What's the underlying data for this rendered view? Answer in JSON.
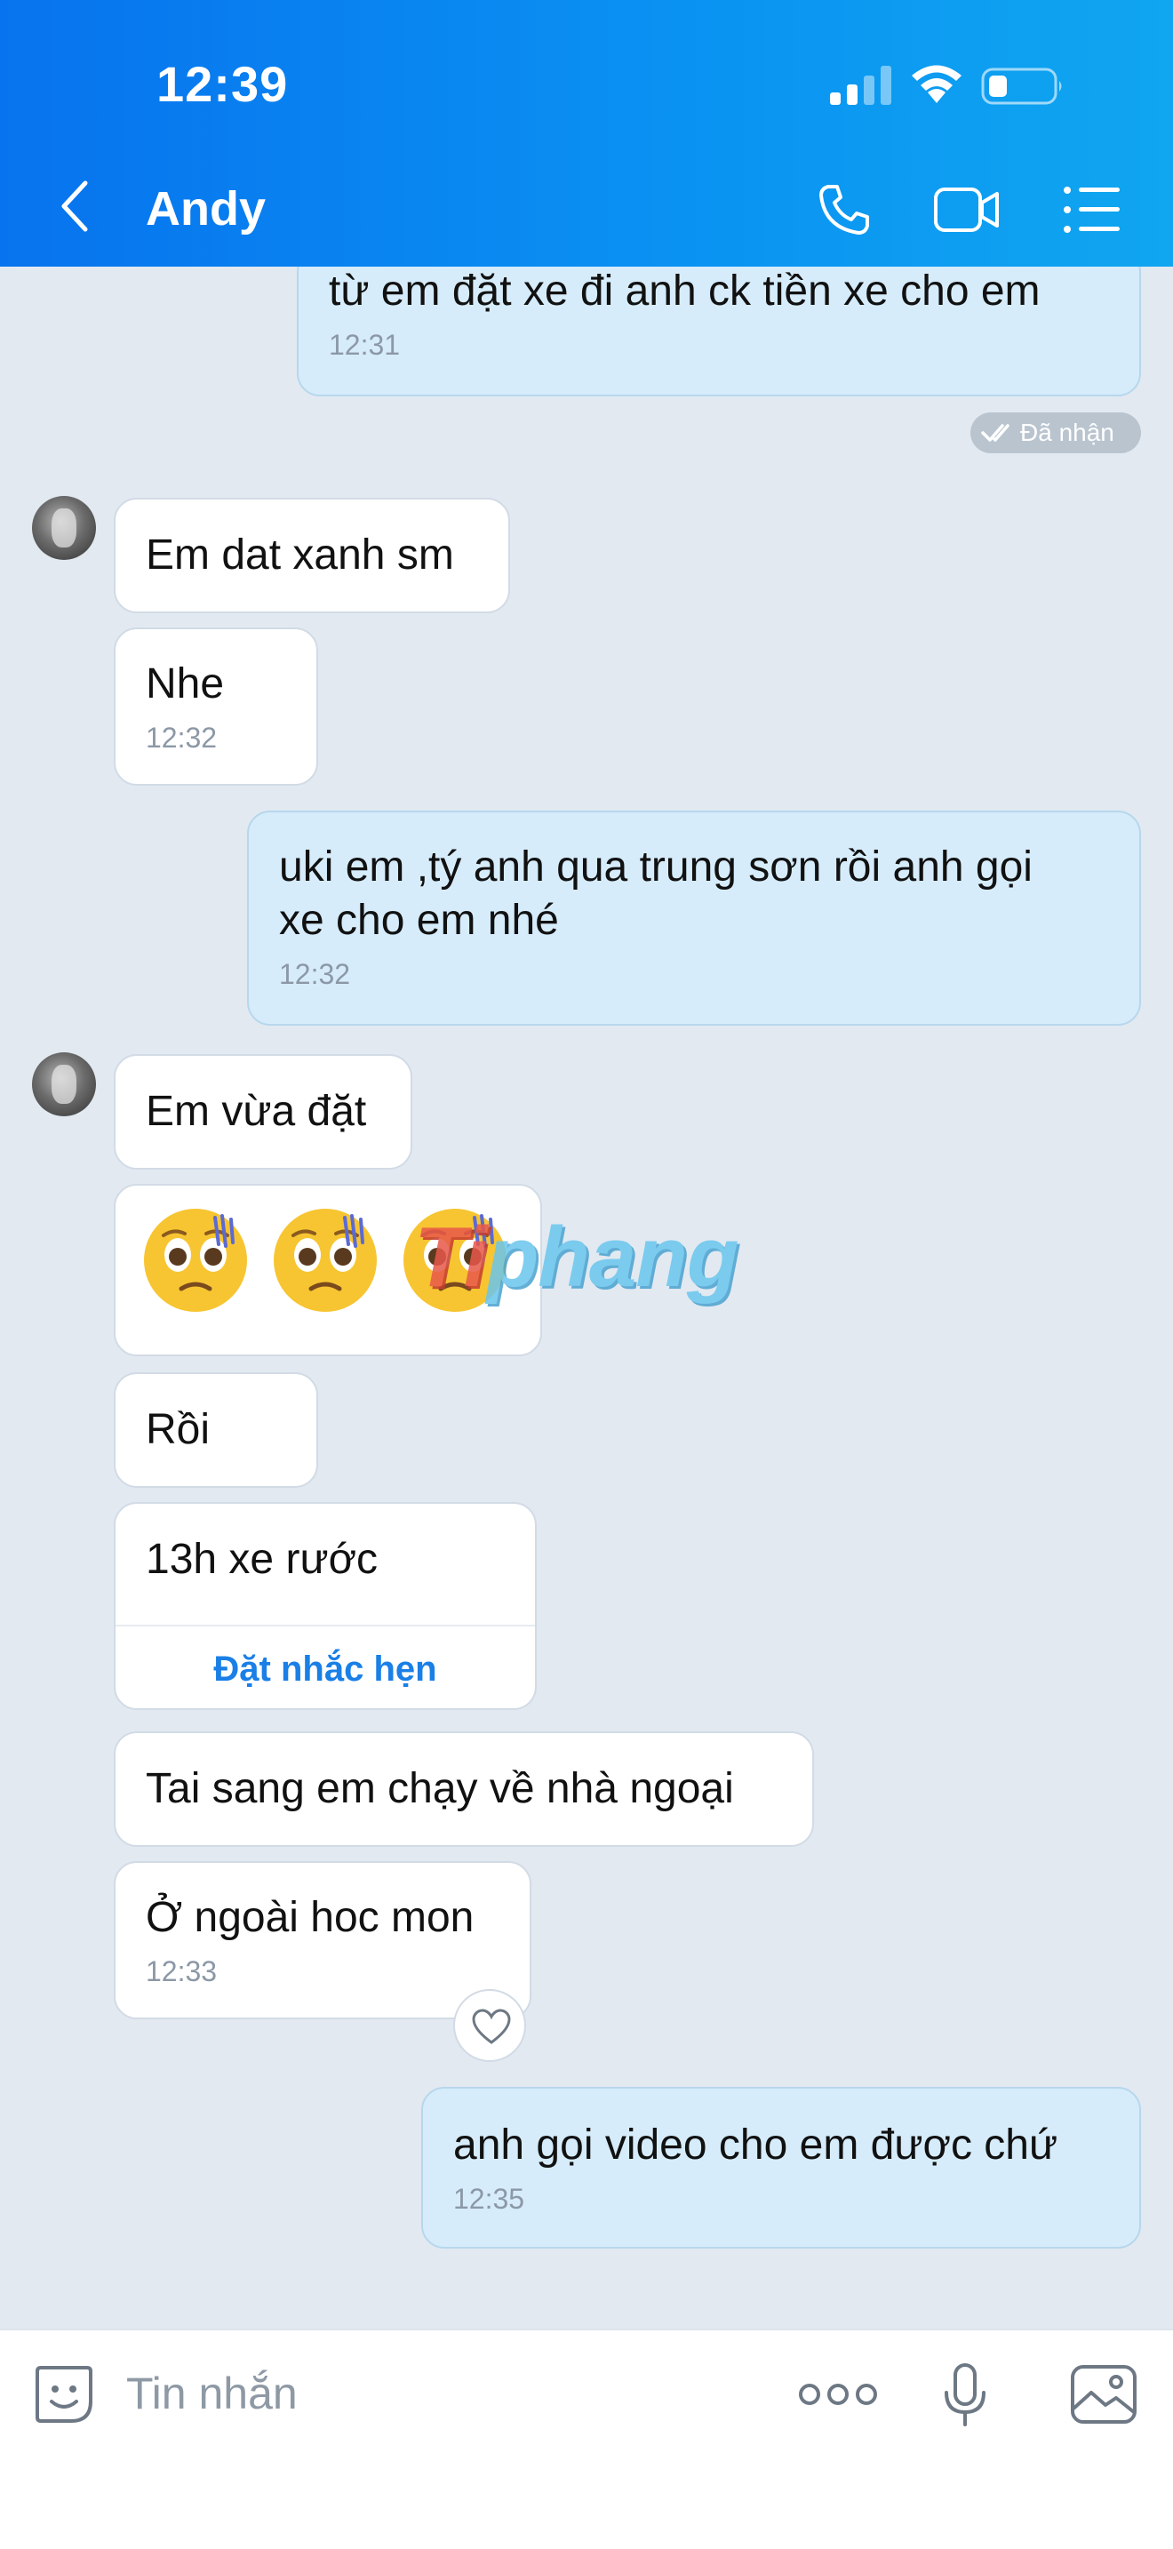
{
  "status_bar": {
    "time": "12:39"
  },
  "header": {
    "contact_name": "Andy",
    "icons": [
      "back-icon",
      "phone-icon",
      "video-call-icon",
      "menu-icon"
    ]
  },
  "messages": [
    {
      "sender": "me",
      "text": "từ em đặt xe đi anh ck tiền xe cho em",
      "time": "12:31"
    },
    {
      "sender": "Andy",
      "text": "Em dat xanh sm",
      "time": ""
    },
    {
      "sender": "Andy",
      "text": "Nhe",
      "time": "12:32"
    },
    {
      "sender": "me",
      "text_line1": "uki em ,tý anh qua trung sơn rồi anh gọi",
      "text_line2": "xe cho em nhé",
      "time": "12:32"
    },
    {
      "sender": "Andy",
      "text": "Em vừa đặt",
      "time": ""
    },
    {
      "sender": "Andy",
      "emojis": [
        "pleading-face",
        "pleading-face",
        "pleading-face"
      ]
    },
    {
      "sender": "Andy",
      "text": "Rồi",
      "time": ""
    },
    {
      "sender": "Andy",
      "text": "13h xe rước",
      "action": "Đặt nhắc hẹn"
    },
    {
      "sender": "Andy",
      "text": "Tai sang em chạy về nhà ngoại",
      "time": ""
    },
    {
      "sender": "Andy",
      "text": "Ở ngoài hoc mon",
      "time": "12:33"
    },
    {
      "sender": "me",
      "text": "anh gọi video cho em được chứ",
      "time": "12:35"
    }
  ],
  "delivery_status": "Đã nhận",
  "watermark": {
    "part_a": "Ti",
    "part_b": "phang"
  },
  "input": {
    "placeholder": "Tin nhắn",
    "icons": [
      "sticker-icon",
      "more-icon",
      "microphone-icon",
      "image-icon"
    ]
  },
  "colors": {
    "header_start": "#0873ee",
    "header_end": "#10a6f0",
    "chat_background": "#e2e9f1",
    "outgoing_bubble": "#d6ecfb",
    "incoming_bubble": "#ffffff",
    "link_blue": "#1a7fe6"
  }
}
